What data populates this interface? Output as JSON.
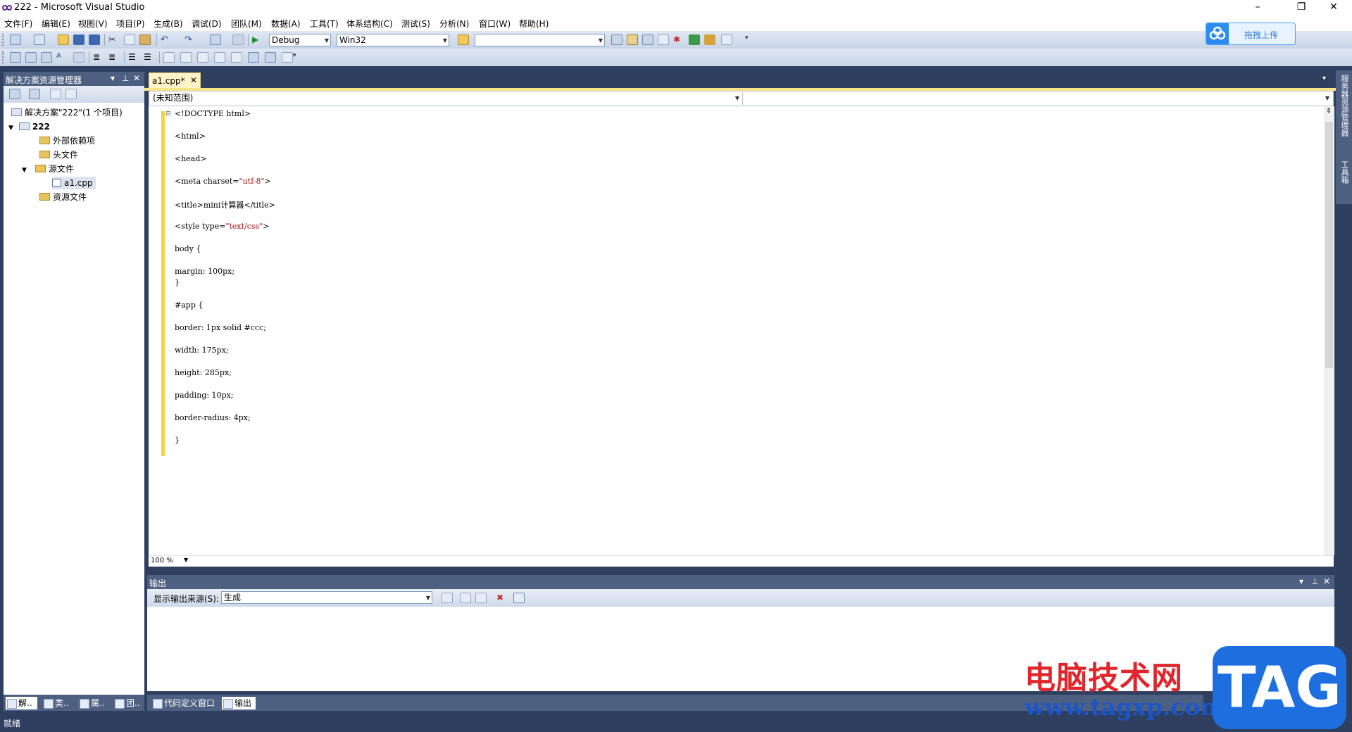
{
  "window": {
    "title": "222 - Microsoft Visual Studio",
    "restore_icon": "restore-icon",
    "close_icon": "close-icon"
  },
  "menu": [
    "文件(F)",
    "编辑(E)",
    "视图(V)",
    "项目(P)",
    "生成(B)",
    "调试(D)",
    "团队(M)",
    "数据(A)",
    "工具(T)",
    "体系结构(C)",
    "测试(S)",
    "分析(N)",
    "窗口(W)",
    "帮助(H)"
  ],
  "toolbar": {
    "config": "Debug",
    "platform": "Win32",
    "find": ""
  },
  "upload_button": "拖拽上传",
  "solution_explorer": {
    "title": "解决方案资源管理器",
    "solution": "解决方案\"222\"(1 个项目)",
    "project": "222",
    "items": [
      "外部依赖项",
      "头文件",
      "源文件",
      "a1.cpp",
      "资源文件"
    ]
  },
  "left_tabs": [
    "解..",
    "类..",
    "属..",
    "团.."
  ],
  "editor": {
    "tab": "a1.cpp*",
    "scope": "(未知范围)",
    "zoom": "100 %",
    "lines": [
      {
        "a": "<!DOCTYPE html>",
        "s": "",
        "b": ""
      },
      {
        "a": "<html>",
        "s": "",
        "b": ""
      },
      {
        "a": "<head>",
        "s": "",
        "b": ""
      },
      {
        "a": "<meta charset=",
        "s": "\"utf-8\"",
        "b": ">"
      },
      {
        "a": "<title>mini计算器</title>",
        "s": "",
        "b": ""
      },
      {
        "a": "<style type=",
        "s": "\"text/css\"",
        "b": ">"
      },
      {
        "a": "body {",
        "s": "",
        "b": ""
      },
      {
        "a": "margin: 100px;",
        "s": "",
        "b": ""
      },
      {
        "a": "}",
        "s": "",
        "b": ""
      },
      {
        "a": "#app {",
        "s": "",
        "b": ""
      },
      {
        "a": "border: 1px solid #ccc;",
        "s": "",
        "b": ""
      },
      {
        "a": "width: 175px;",
        "s": "",
        "b": ""
      },
      {
        "a": "height: 285px;",
        "s": "",
        "b": ""
      },
      {
        "a": "padding: 10px;",
        "s": "",
        "b": ""
      },
      {
        "a": "border-radius: 4px;",
        "s": "",
        "b": ""
      },
      {
        "a": "}",
        "s": "",
        "b": ""
      }
    ]
  },
  "output": {
    "title": "输出",
    "source_label": "显示输出来源(S):",
    "source_value": "生成"
  },
  "bottom_tabs": [
    "代码定义窗口",
    "输出"
  ],
  "right_side": [
    "服务器资源管理器",
    "工具箱"
  ],
  "status": "就绪",
  "watermark": {
    "site_name": "电脑技术网",
    "url": "www.tagxp.com",
    "tag": "TAG"
  }
}
